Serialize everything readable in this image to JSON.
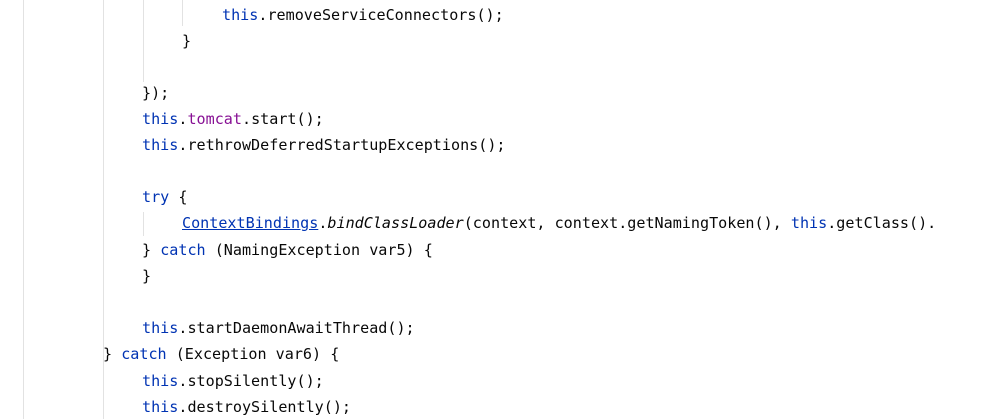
{
  "editor": {
    "colors": {
      "keyword": "#0033b3",
      "field": "#871094",
      "text": "#080808",
      "indent_guide": "#e2e2e2",
      "background": "#ffffff"
    },
    "lines": {
      "l1": {
        "this": "this",
        "rest": ".removeServiceConnectors();"
      },
      "l2": {
        "brace": "}"
      },
      "l4": {
        "close": "});"
      },
      "l5": {
        "this": "this",
        "dot": ".",
        "field": "tomcat",
        "rest": ".start();"
      },
      "l6": {
        "this": "this",
        "rest": ".rethrowDeferredStartupExceptions();"
      },
      "l8": {
        "kw": "try",
        "rest": " {"
      },
      "l9": {
        "type": "ContextBindings",
        "dot": ".",
        "method": "bindClassLoader",
        "args": "(context, context.getNamingToken(), ",
        "this": "this",
        "rest": ".getClass()."
      },
      "l10": {
        "pre": "} ",
        "kw": "catch",
        "rest": " (NamingException var5) {"
      },
      "l11": {
        "brace": "}"
      },
      "l13": {
        "this": "this",
        "rest": ".startDaemonAwaitThread();"
      },
      "l14": {
        "pre": "} ",
        "kw": "catch",
        "rest": " (Exception var6) {"
      },
      "l15": {
        "this": "this",
        "rest": ".stopSilently();"
      },
      "l16": {
        "this": "this",
        "rest": ".destroySilently();"
      }
    }
  }
}
